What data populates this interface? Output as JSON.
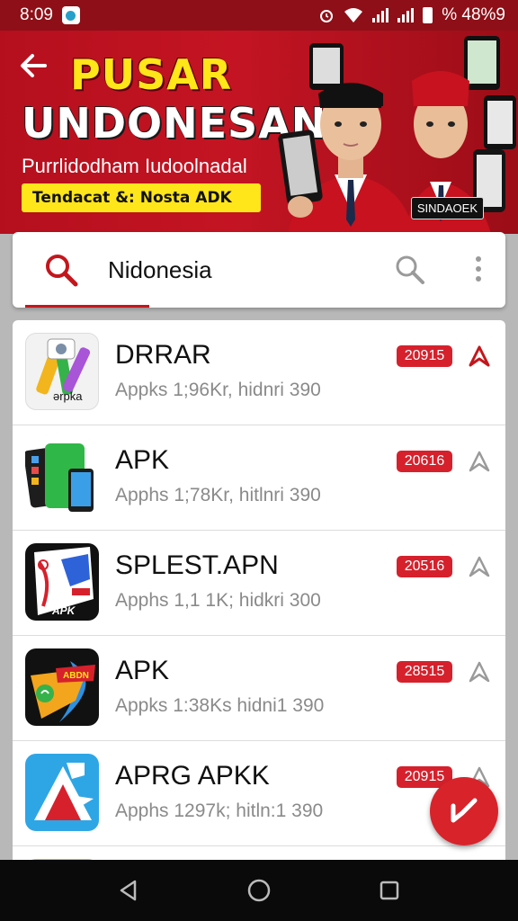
{
  "status_bar": {
    "time": "8:09",
    "battery_text": "% 48%9",
    "icons": [
      "app-notification-icon",
      "alarm-icon",
      "wifi-icon",
      "signal-icon",
      "signal-icon",
      "battery-icon"
    ]
  },
  "banner": {
    "title_line1": "PUSAR",
    "title_line2": "UNDONESAN",
    "subtitle": "Purrlidodham Iudoolnadal",
    "pill_text": "Tendacat &: Nosta ADK",
    "tag": "SINDAOEK"
  },
  "search": {
    "query": "Nidonesia"
  },
  "apps": [
    {
      "name": "DRRAR",
      "meta": "Appks 1;96Kr, hidnri 390",
      "badge": "20915",
      "icon": "pencil-app-icon",
      "icon_label": "ərpka",
      "bookmarked": true
    },
    {
      "name": "APK",
      "meta": "Apphs 1;78Kr, hitlnri 390",
      "badge": "20616",
      "icon": "phones-app-icon",
      "icon_label": "",
      "bookmarked": false
    },
    {
      "name": "SPLEST.APN",
      "meta": "Apphs 1,1 1K; hidkri 300",
      "badge": "20516",
      "icon": "apk-book-app-icon",
      "icon_label": "APK",
      "bookmarked": false
    },
    {
      "name": "APK",
      "meta": "Appks 1:38Ks hidni1 390",
      "badge": "28515",
      "icon": "chat-arrow-app-icon",
      "icon_label": "ABDN",
      "bookmarked": false
    },
    {
      "name": "APRG APKK",
      "meta": "Apphs 1297k; hitln:1 390",
      "badge": "20915",
      "icon": "mountain-app-icon",
      "icon_label": "",
      "bookmarked": false
    }
  ],
  "colors": {
    "accent": "#c4161c",
    "banner": "#b50f1d",
    "badge": "#d6212c",
    "title_yellow": "#ffe619"
  }
}
